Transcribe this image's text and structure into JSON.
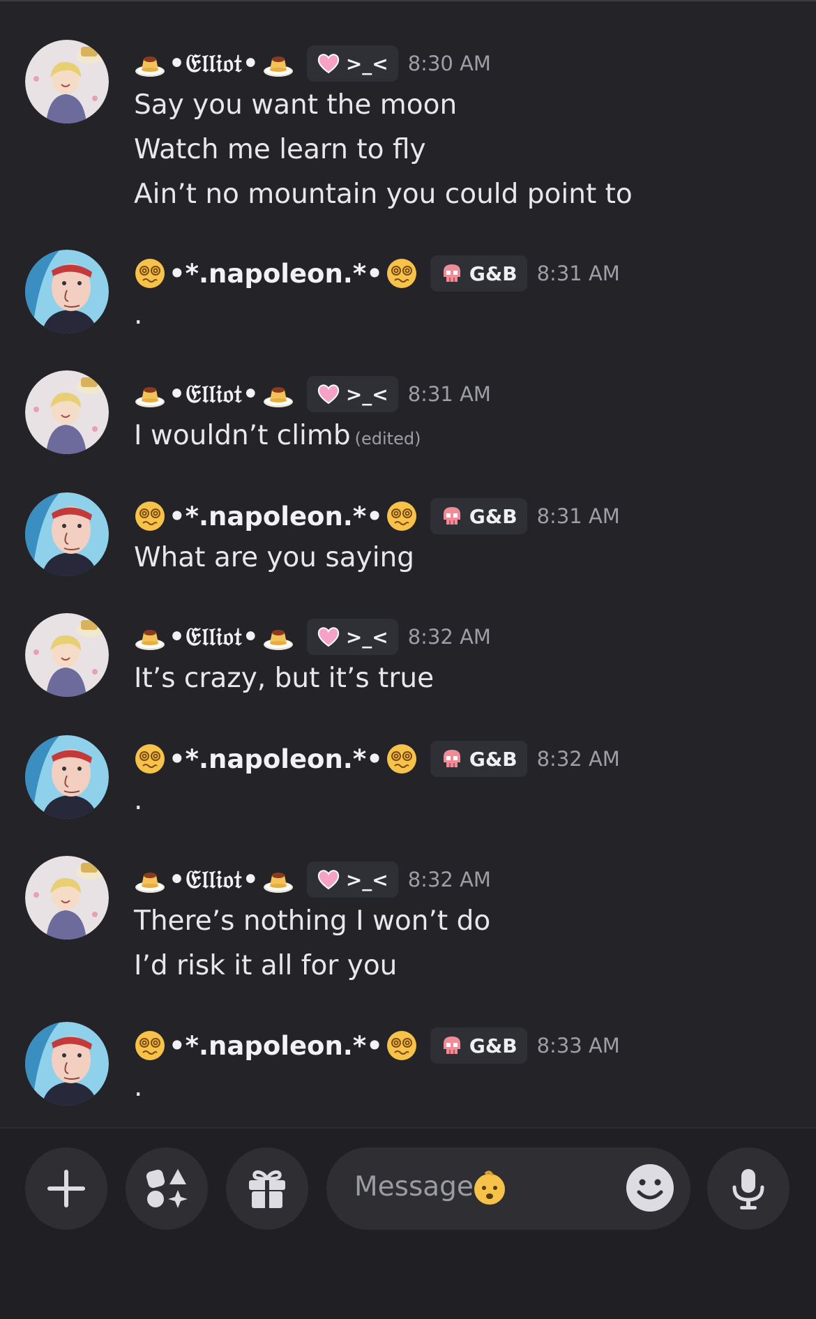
{
  "messages": [
    {
      "author": "•𝔈𝔩𝔩𝔦𝔬𝔱•",
      "tag": ">_<",
      "time": "8:30 AM",
      "lines": [
        "Say you want the moon",
        "Watch me learn to fly",
        "Ain’t no mountain you could point to"
      ]
    },
    {
      "author": "•*.napoleon.*•",
      "tag": "G&B",
      "time": "8:31 AM",
      "lines": [
        "."
      ]
    },
    {
      "author": "•𝔈𝔩𝔩𝔦𝔬𝔱•",
      "tag": ">_<",
      "time": "8:31 AM",
      "lines": [
        "I wouldn’t climb"
      ],
      "edited": "(edited)"
    },
    {
      "author": "•*.napoleon.*•",
      "tag": "G&B",
      "time": "8:31 AM",
      "lines": [
        "What are you saying"
      ]
    },
    {
      "author": "•𝔈𝔩𝔩𝔦𝔬𝔱•",
      "tag": ">_<",
      "time": "8:32 AM",
      "lines": [
        "It’s crazy, but it’s true"
      ]
    },
    {
      "author": "•*.napoleon.*•",
      "tag": "G&B",
      "time": "8:32 AM",
      "lines": [
        "."
      ]
    },
    {
      "author": "•𝔈𝔩𝔩𝔦𝔬𝔱•",
      "tag": ">_<",
      "time": "8:32 AM",
      "lines": [
        "There’s nothing I won’t do",
        "I’d risk it all for you"
      ]
    },
    {
      "author": "•*.napoleon.*•",
      "tag": "G&B",
      "time": "8:33 AM",
      "lines": [
        "."
      ]
    }
  ],
  "icons": {
    "elliot_name_emoji": "flan-pudding-icon",
    "napoleon_name_emoji": "dizzy-face-icon",
    "elliot_tag_icon": "pink-heart-icon",
    "napoleon_tag_icon": "pink-skull-icon"
  },
  "composer": {
    "placeholder": "Message",
    "buttons": [
      "plus-icon",
      "apps-icon",
      "gift-icon",
      "smile-icon",
      "microphone-icon"
    ]
  },
  "colors": {
    "background": "#242428",
    "tag_background": "#2f3036",
    "timestamp": "#9d9ea6",
    "composer_button": "#2e2e33"
  }
}
